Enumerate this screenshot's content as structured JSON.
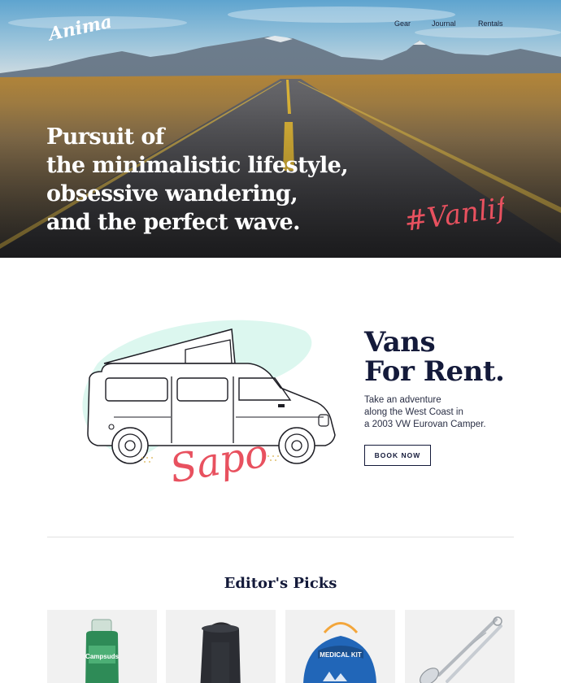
{
  "brand": {
    "logo_text": "Animal"
  },
  "nav": {
    "items": [
      "Gear",
      "Journal",
      "Rentals"
    ]
  },
  "hero": {
    "headline_lines": [
      "Pursuit of",
      "the minimalistic lifestyle,",
      "obsessive wandering,",
      "and the perfect wave."
    ],
    "hashtag": "#Vanlife"
  },
  "rent": {
    "van_name": "Sapo",
    "title_lines": [
      "Vans",
      "For Rent."
    ],
    "description_lines": [
      "Take an adventure",
      "along the West Coast in",
      "a 2003 VW Eurovan Camper."
    ],
    "cta_label": "BOOK NOW"
  },
  "picks": {
    "title": "Editor's Picks",
    "products": [
      {
        "icon": "campsuds-bottle-icon",
        "label": "Campsuds"
      },
      {
        "icon": "speaker-icon"
      },
      {
        "icon": "first-aid-kit-icon",
        "label": "MEDICAL KIT"
      },
      {
        "icon": "utensils-icon"
      }
    ]
  },
  "colors": {
    "accent": "#e8515f",
    "navy": "#141a3a",
    "mint": "#dcf7ef"
  }
}
